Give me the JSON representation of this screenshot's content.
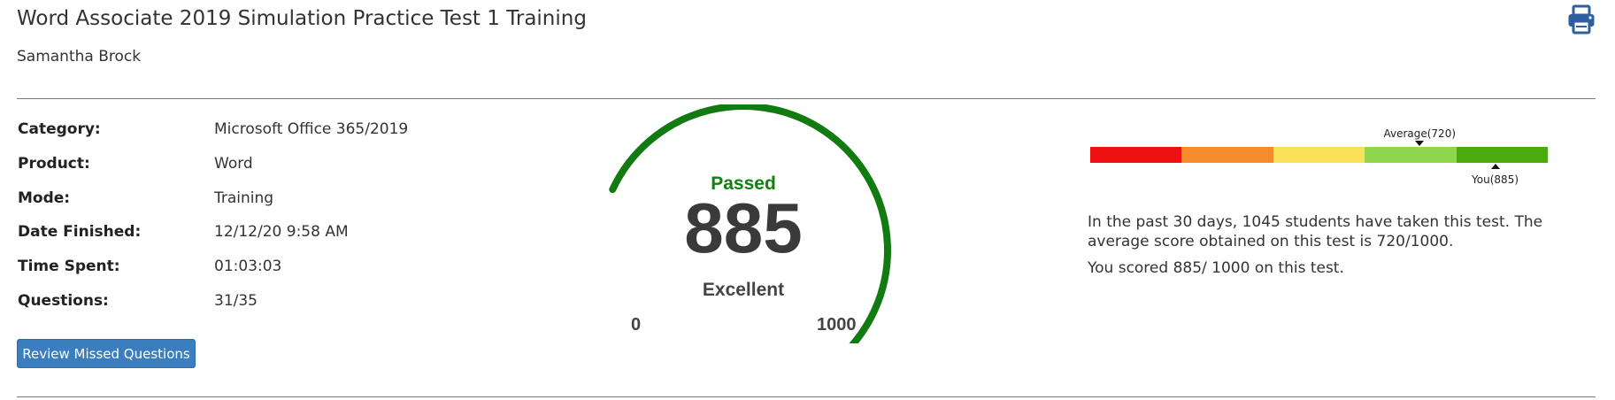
{
  "header": {
    "title": "Word Associate 2019 Simulation Practice Test 1 Training",
    "student": "Samantha Brock",
    "print_icon": "print-icon"
  },
  "details": [
    {
      "label": "Category:",
      "value": "Microsoft Office 365/2019"
    },
    {
      "label": "Product:",
      "value": "Word"
    },
    {
      "label": "Mode:",
      "value": "Training"
    },
    {
      "label": "Date Finished:",
      "value": "12/12/20 9:58 AM"
    },
    {
      "label": "Time Spent:",
      "value": "01:03:03"
    },
    {
      "label": "Questions:",
      "value": "31/35"
    }
  ],
  "actions": {
    "review_label": "Review Missed Questions"
  },
  "gauge": {
    "status": "Passed",
    "score": "885",
    "rating": "Excellent",
    "min_label": "0",
    "max_label": "1000",
    "min": 0,
    "max": 1000,
    "value": 885,
    "fill_color": "#117a11",
    "track_color": "#e0e0e0",
    "status_color": "#108010"
  },
  "scale": {
    "segments": [
      "#ee1111",
      "#f68b2c",
      "#fbe059",
      "#8ed650",
      "#4aaa0e"
    ],
    "min": 0,
    "max": 1000,
    "average_label": "Average(720)",
    "average_value": 720,
    "you_label": "You(885)",
    "you_value": 885
  },
  "summary": {
    "line1": "In the past 30 days, 1045 students have taken this test. The average score obtained on this test is 720/1000.",
    "line2": "You scored 885/ 1000 on this test."
  }
}
